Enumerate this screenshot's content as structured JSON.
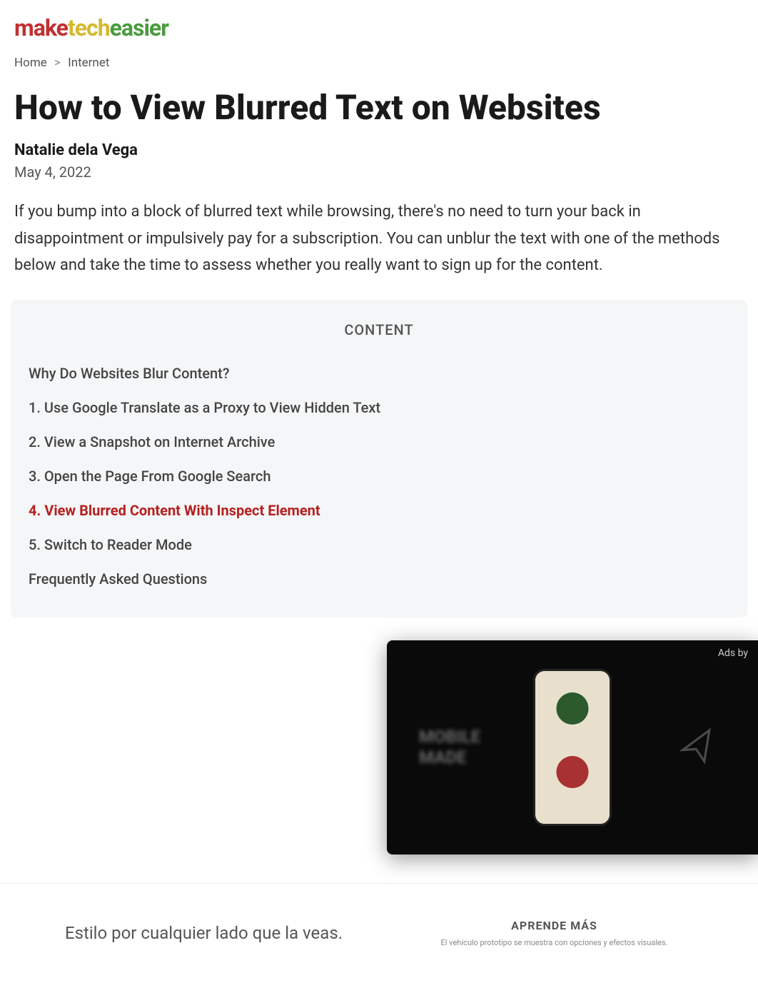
{
  "logo": {
    "part1": "make",
    "part2": "tech",
    "part3": "easier"
  },
  "breadcrumb": {
    "home": "Home",
    "separator": ">",
    "category": "Internet"
  },
  "article": {
    "title": "How to View Blurred Text on Websites",
    "author": "Natalie dela Vega",
    "date": "May 4, 2022",
    "intro": "If you bump into a block of blurred text while browsing, there's no need to turn your back in disappointment or impulsively pay for a subscription. You can unblur the text with one of the methods below and take the time to assess whether you really want to sign up for the content."
  },
  "toc": {
    "heading": "CONTENT",
    "items": [
      {
        "label": "Why Do Websites Blur Content?",
        "active": false
      },
      {
        "label": "1. Use Google Translate as a Proxy to View Hidden Text",
        "active": false
      },
      {
        "label": "2. View a Snapshot on Internet Archive",
        "active": false
      },
      {
        "label": "3. Open the Page From Google Search",
        "active": false
      },
      {
        "label": "4. View Blurred Content With Inspect Element",
        "active": true
      },
      {
        "label": "5. Switch to Reader Mode",
        "active": false
      },
      {
        "label": "Frequently Asked Questions",
        "active": false
      }
    ]
  },
  "videoAd": {
    "label": "Ads by",
    "blurText1": "MOBILE",
    "blurText2": "MADE"
  },
  "bannerAd": {
    "headline": "Estilo por cualquier lado que la veas.",
    "cta": "APRENDE MÁS",
    "disclaimer": "El vehículo prototipo se muestra con opciones y efectos visuales."
  }
}
